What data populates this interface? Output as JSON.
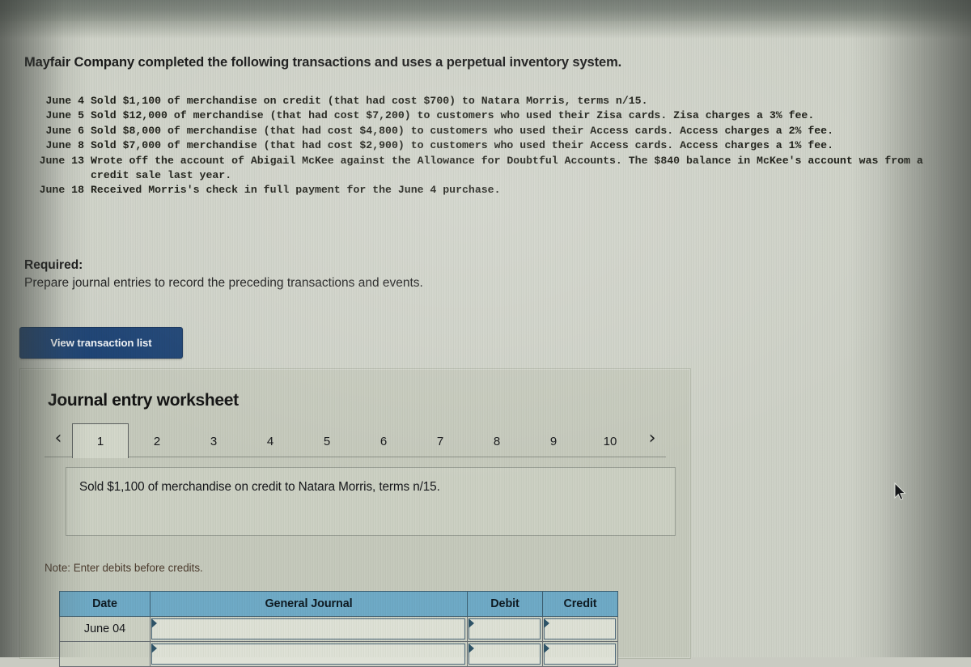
{
  "prompt": {
    "heading": "Mayfair Company completed the following transactions and uses a perpetual inventory system.",
    "transactions": [
      {
        "date": "June 4",
        "text": "Sold $1,100 of merchandise on credit (that had cost $700) to Natara Morris, terms n/15."
      },
      {
        "date": "June 5",
        "text": "Sold $12,000 of merchandise (that had cost $7,200) to customers who used their Zisa cards. Zisa charges a 3% fee."
      },
      {
        "date": "June 6",
        "text": "Sold $8,000 of merchandise (that had cost $4,800) to customers who used their Access cards. Access charges a 2% fee."
      },
      {
        "date": "June 8",
        "text": "Sold $7,000 of merchandise (that had cost $2,900) to customers who used their Access cards. Access charges a 1% fee."
      },
      {
        "date": "June 13",
        "text": "Wrote off the account of Abigail McKee against the Allowance for Doubtful Accounts. The $840 balance in McKee's account was from a credit sale last year."
      },
      {
        "date": "June 18",
        "text": "Received Morris's check in full payment for the June 4 purchase."
      }
    ],
    "required_label": "Required:",
    "required_text": "Prepare journal entries to record the preceding transactions and events."
  },
  "buttons": {
    "view_transaction_list": "View transaction list"
  },
  "worksheet": {
    "title": "Journal entry worksheet",
    "prev_chevron": "‹",
    "next_chevron": "›",
    "tabs": [
      {
        "label": "1",
        "selected": true
      },
      {
        "label": "2",
        "selected": false
      },
      {
        "label": "3",
        "selected": false
      },
      {
        "label": "4",
        "selected": false
      },
      {
        "label": "5",
        "selected": false
      },
      {
        "label": "6",
        "selected": false
      },
      {
        "label": "7",
        "selected": false
      },
      {
        "label": "8",
        "selected": false
      },
      {
        "label": "9",
        "selected": false
      },
      {
        "label": "10",
        "selected": false
      }
    ],
    "entry_prompt": "Sold $1,100 of merchandise on credit to Natara Morris, terms n/15.",
    "note": "Note: Enter debits before credits.",
    "table": {
      "headers": [
        "Date",
        "General Journal",
        "Debit",
        "Credit"
      ],
      "rows": [
        {
          "date": "June 04",
          "general_journal": "",
          "debit": "",
          "credit": ""
        },
        {
          "date": "",
          "general_journal": "",
          "debit": "",
          "credit": ""
        }
      ]
    }
  },
  "colors": {
    "button_navy": "#1c4274",
    "table_header_blue": "#6fabc7",
    "page_background": "#cfd2c8",
    "panel_background": "#c6cabd",
    "note_text": "#4b3a2c",
    "field_border": "#4f6a7c"
  }
}
